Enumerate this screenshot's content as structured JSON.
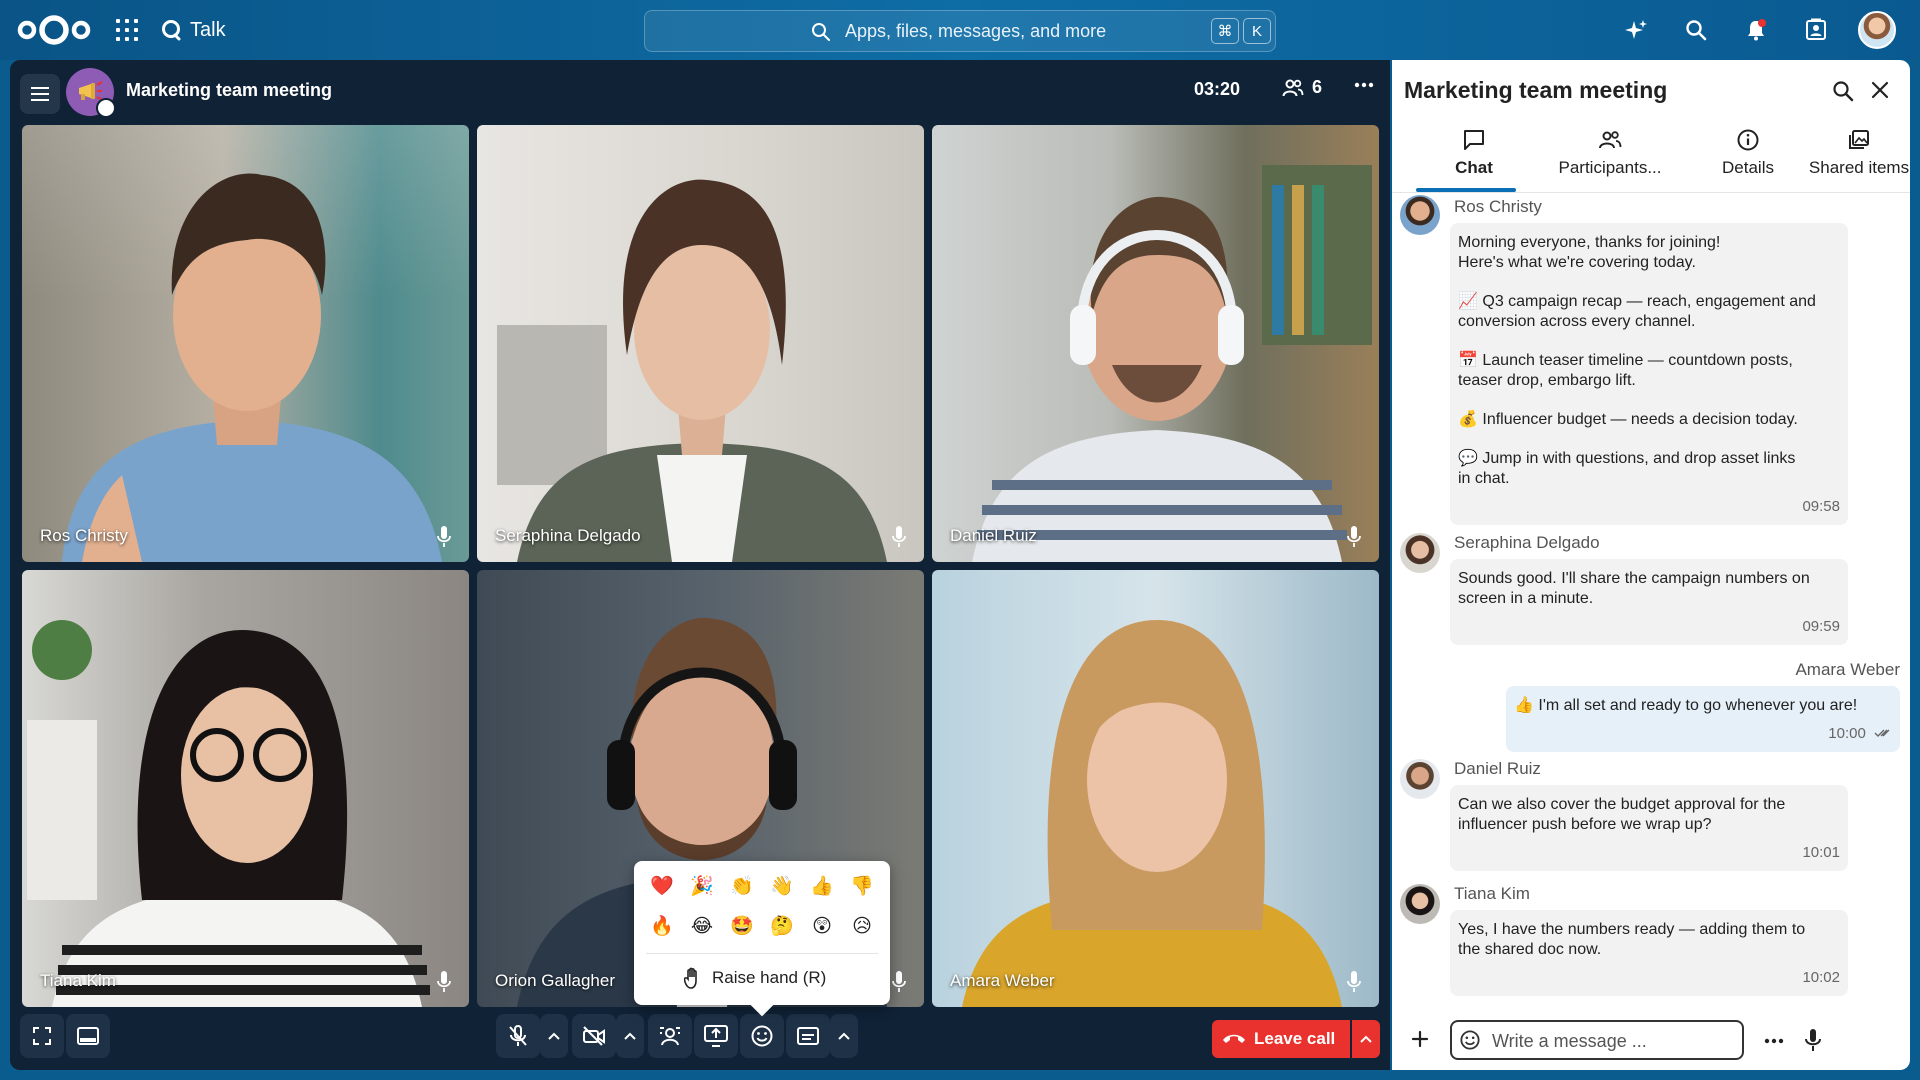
{
  "topbar": {
    "app_name": "Talk",
    "search_placeholder": "Apps, files, messages, and more",
    "shortcut_keys": [
      "⌘",
      "K"
    ]
  },
  "call": {
    "title": "Marketing team meeting",
    "timer": "03:20",
    "participant_count": "6",
    "tiles": [
      {
        "name": "Ros Christy"
      },
      {
        "name": "Seraphina Delgado"
      },
      {
        "name": "Daniel Ruiz"
      },
      {
        "name": "Tiana Kim"
      },
      {
        "name": "Orion Gallagher"
      },
      {
        "name": "Amara Weber"
      }
    ],
    "leave_label": "Leave call",
    "reactions": {
      "emojis": [
        "❤️",
        "🎉",
        "👏",
        "👋",
        "👍",
        "👎",
        "🔥",
        "😂",
        "🤩",
        "🤔",
        "😲",
        "😥"
      ],
      "raise_hand_label": "Raise hand (R)"
    }
  },
  "sidebar": {
    "title": "Marketing team meeting",
    "tabs": [
      {
        "label": "Chat"
      },
      {
        "label": "Participants..."
      },
      {
        "label": "Details"
      },
      {
        "label": "Shared items"
      }
    ],
    "messages": [
      {
        "sender": "Ros Christy",
        "lines": [
          "Morning everyone, thanks for joining!",
          "Here's what we're covering today.",
          "",
          "📈 Q3 campaign recap — reach, engagement and",
          "conversion across every channel.",
          "",
          "📅 Launch teaser timeline — countdown posts,",
          "teaser drop, embargo lift.",
          "",
          "💰 Influencer budget — needs a decision today.",
          "",
          "💬 Jump in with questions, and drop asset links",
          "in chat."
        ],
        "time": "09:58"
      },
      {
        "sender": "Seraphina Delgado",
        "lines": [
          "Sounds good. I'll share the campaign numbers on",
          "screen in a minute."
        ],
        "time": "09:59"
      },
      {
        "sender": "Amara Weber",
        "lines": [
          "👍 I'm all set and ready to go whenever you are!"
        ],
        "time": "10:00"
      },
      {
        "sender": "Daniel Ruiz",
        "lines": [
          "Can we also cover the budget approval for the",
          "influencer push before we wrap up?"
        ],
        "time": "10:01"
      },
      {
        "sender": "Tiana Kim",
        "lines": [
          "Yes, I have the numbers ready — adding them to",
          "the shared doc now."
        ],
        "time": "10:02"
      }
    ],
    "composer_placeholder": "Write a message ..."
  },
  "colors": {
    "topbar": "#0b5c8e",
    "call_bg": "#0f2236",
    "accent": "#0b6fb6",
    "leave": "#e9322d"
  }
}
